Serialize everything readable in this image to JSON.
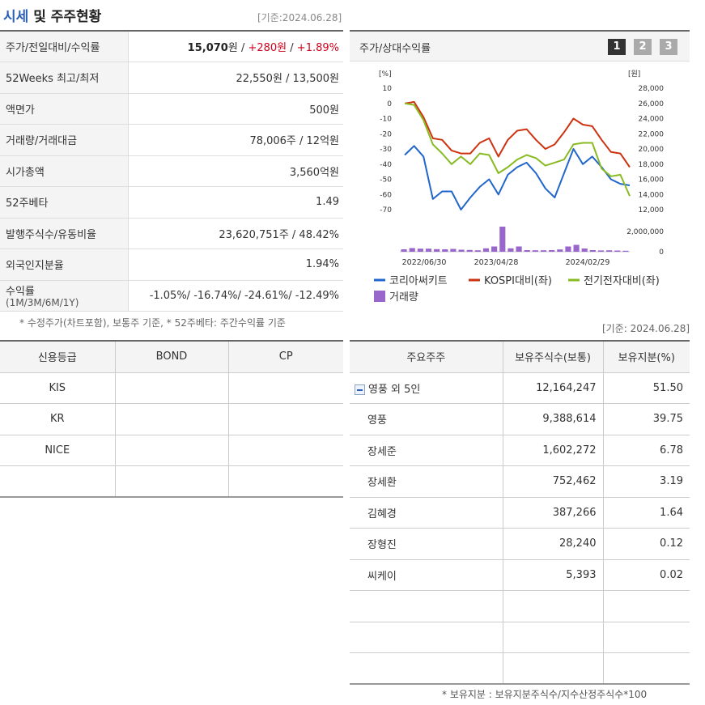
{
  "header": {
    "title_blue": "시세",
    "title_rest": " 및 주주현황",
    "base_date": "[기준:2024.06.28]"
  },
  "price_table": [
    {
      "label": "주가/전일대비/수익률",
      "value_bold": "15,070",
      "unit": "원",
      "sep1": " / ",
      "change": "+280원",
      "sep2": " / ",
      "rate": "+1.89%"
    },
    {
      "label": "52Weeks 최고/최저",
      "value": "22,550원 / 13,500원"
    },
    {
      "label": "액면가",
      "value": "500원"
    },
    {
      "label": "거래량/거래대금",
      "value": "78,006주 / 12억원"
    },
    {
      "label": "시가총액",
      "value": "3,560억원"
    },
    {
      "label": "52주베타",
      "value": "1.49"
    },
    {
      "label": "발행주식수/유동비율",
      "value": "23,620,751주 / 48.42%"
    },
    {
      "label": "외국인지분율",
      "value": "1.94%"
    },
    {
      "label": "수익률",
      "label_sub": "(1M/3M/6M/1Y)",
      "value": "-1.05%/ -16.74%/ -24.61%/ -12.49%"
    }
  ],
  "price_note": "* 수정주가(차트포함), 보통주 기준, * 52주베타: 주간수익률 기준",
  "credit_table": {
    "headers": [
      "신용등급",
      "BOND",
      "CP"
    ],
    "rows": [
      [
        "KIS",
        "",
        ""
      ],
      [
        "KR",
        "",
        ""
      ],
      [
        "NICE",
        "",
        ""
      ],
      [
        "",
        "",
        ""
      ]
    ]
  },
  "chart_panel": {
    "title": "주가/상대수익률",
    "tabs": [
      "1",
      "2",
      "3"
    ],
    "active_tab": "1",
    "colors": {
      "active_tab": "#333333",
      "inactive_tab": "#aaaaaa"
    }
  },
  "chart_data": {
    "type": "line",
    "left_unit": "[%]",
    "right_unit": "[원]",
    "y_left_ticks": [
      "10",
      "0",
      "-10",
      "-20",
      "-30",
      "-40",
      "-50",
      "-60",
      "-70"
    ],
    "y_right_ticks": [
      "28,000",
      "26,000",
      "24,000",
      "22,000",
      "20,000",
      "18,000",
      "16,000",
      "14,000",
      "12,000"
    ],
    "volume_ticks": [
      "2,000,000",
      "0"
    ],
    "x_labels": [
      "2022/06/30",
      "2023/04/28",
      "2024/02/29"
    ],
    "ylim_left": [
      -70,
      10
    ],
    "ylim_right": [
      12000,
      28000
    ],
    "series": [
      {
        "name": "코리아써키트",
        "color": "#2266cc",
        "axis": "left",
        "values": [
          -34,
          -28,
          -35,
          -63,
          -58,
          -58,
          -70,
          -62,
          -55,
          -50,
          -60,
          -47,
          -42,
          -39,
          -46,
          -56,
          -62,
          -46,
          -30,
          -40,
          -35,
          -42,
          -50,
          -53,
          -54
        ]
      },
      {
        "name": "KOSPI대비(좌)",
        "color": "#cc3311",
        "axis": "left",
        "values": [
          0,
          1,
          -9,
          -23,
          -24,
          -31,
          -33,
          -33,
          -26,
          -23,
          -35,
          -24,
          -18,
          -17,
          -24,
          -30,
          -27,
          -19,
          -10,
          -14,
          -15,
          -24,
          -32,
          -33,
          -42
        ]
      },
      {
        "name": "전기전자대비(좌)",
        "color": "#88bb22",
        "axis": "left",
        "values": [
          0,
          -1,
          -11,
          -27,
          -33,
          -40,
          -35,
          -40,
          -33,
          -34,
          -46,
          -42,
          -37,
          -34,
          -36,
          -41,
          -39,
          -37,
          -27,
          -26,
          -26,
          -43,
          -48,
          -47,
          -61
        ]
      },
      {
        "name": "거래량",
        "color": "#9966cc",
        "axis": "volume",
        "values": [
          300000,
          450000,
          380000,
          380000,
          320000,
          300000,
          350000,
          250000,
          220000,
          180000,
          420000,
          650000,
          3100000,
          420000,
          650000,
          200000,
          180000,
          180000,
          200000,
          280000,
          650000,
          850000,
          400000,
          200000,
          160000,
          180000,
          150000,
          120000
        ]
      }
    ],
    "volume_max": 2500000
  },
  "shareholder_base_date": "[기준: 2024.06.28]",
  "shareholder_table": {
    "headers": [
      "주요주주",
      "보유주식수(보통)",
      "보유지분(%)"
    ],
    "rows": [
      {
        "name": "영풍 외 5인",
        "shares": "12,164,247",
        "ratio": "51.50",
        "group": true
      },
      {
        "name": "영풍",
        "shares": "9,388,614",
        "ratio": "39.75"
      },
      {
        "name": "장세준",
        "shares": "1,602,272",
        "ratio": "6.78"
      },
      {
        "name": "장세환",
        "shares": "752,462",
        "ratio": "3.19"
      },
      {
        "name": "김혜경",
        "shares": "387,266",
        "ratio": "1.64"
      },
      {
        "name": "장형진",
        "shares": "28,240",
        "ratio": "0.12"
      },
      {
        "name": "씨케이",
        "shares": "5,393",
        "ratio": "0.02"
      },
      {
        "name": "",
        "shares": "",
        "ratio": ""
      },
      {
        "name": "",
        "shares": "",
        "ratio": ""
      },
      {
        "name": "",
        "shares": "",
        "ratio": ""
      }
    ]
  },
  "shareholder_note": "* 보유지분 : 보유지분주식수/지수산정주식수*100"
}
